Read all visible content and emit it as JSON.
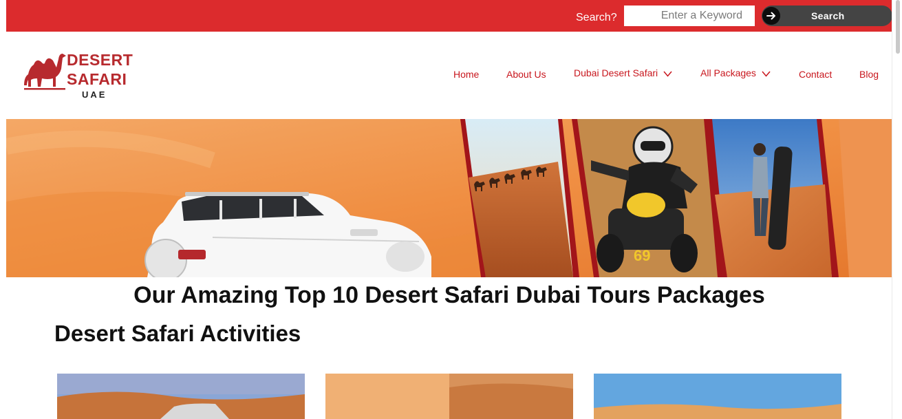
{
  "topbar": {
    "search_label": "Search?",
    "search_placeholder": "Enter a Keyword",
    "search_button": "Search"
  },
  "logo": {
    "line1": "DESERT",
    "line2": "SAFARI",
    "line3": "UAE"
  },
  "nav": {
    "items": [
      {
        "label": "Home"
      },
      {
        "label": "About Us"
      },
      {
        "label": "Dubai Desert Safari"
      },
      {
        "label": "All Packages"
      },
      {
        "label": "Contact"
      },
      {
        "label": "Blog"
      }
    ]
  },
  "hero": {
    "quad_number": "69"
  },
  "main": {
    "title": "Our Amazing Top 10 Desert Safari Dubai Tours Packages",
    "section_title": "Desert Safari Activities"
  },
  "colors": {
    "brand_red": "#dc2b2d",
    "logo_red": "#b72a2e",
    "nav_red": "#c8161d",
    "button_dark": "#444444"
  }
}
